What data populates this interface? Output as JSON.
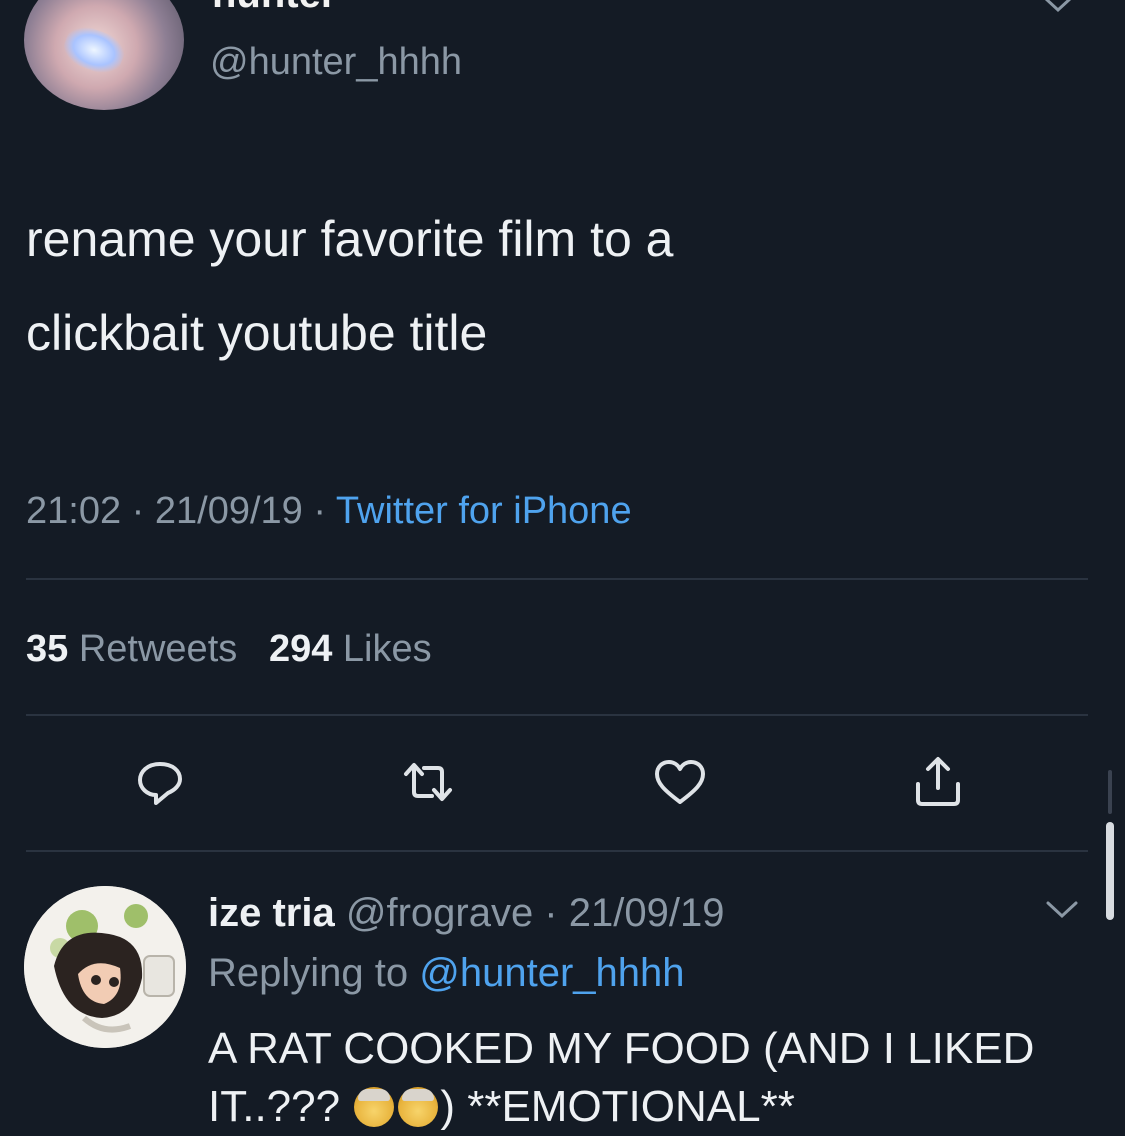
{
  "tweet": {
    "display_name": "hunter",
    "handle": "@hunter_hhhh",
    "text_line1": "rename your favorite film to a",
    "text_line2": "clickbait youtube title",
    "time": "21:02",
    "date": "21/09/19",
    "source": "Twitter for iPhone",
    "retweets_count": "35",
    "retweets_label": "Retweets",
    "likes_count": "294",
    "likes_label": "Likes"
  },
  "actions": [
    {
      "icon": "reply-icon"
    },
    {
      "icon": "retweet-icon"
    },
    {
      "icon": "like-icon"
    },
    {
      "icon": "share-icon"
    }
  ],
  "reply": {
    "name": "ize tria",
    "handle": "@frograve",
    "date": "21/09/19",
    "replying_label": "Replying to",
    "replying_to": "@hunter_hhhh",
    "text_part1": "A RAT COOKED MY FOOD (AND I LIKED IT..???",
    "text_part2": ") **EMOTIONAL**",
    "emojis": [
      "exploding-head-emoji",
      "exploding-head-emoji"
    ]
  },
  "colors": {
    "background": "#141b25",
    "link_blue": "#4fa3ee",
    "secondary_text": "#8b98a5"
  }
}
